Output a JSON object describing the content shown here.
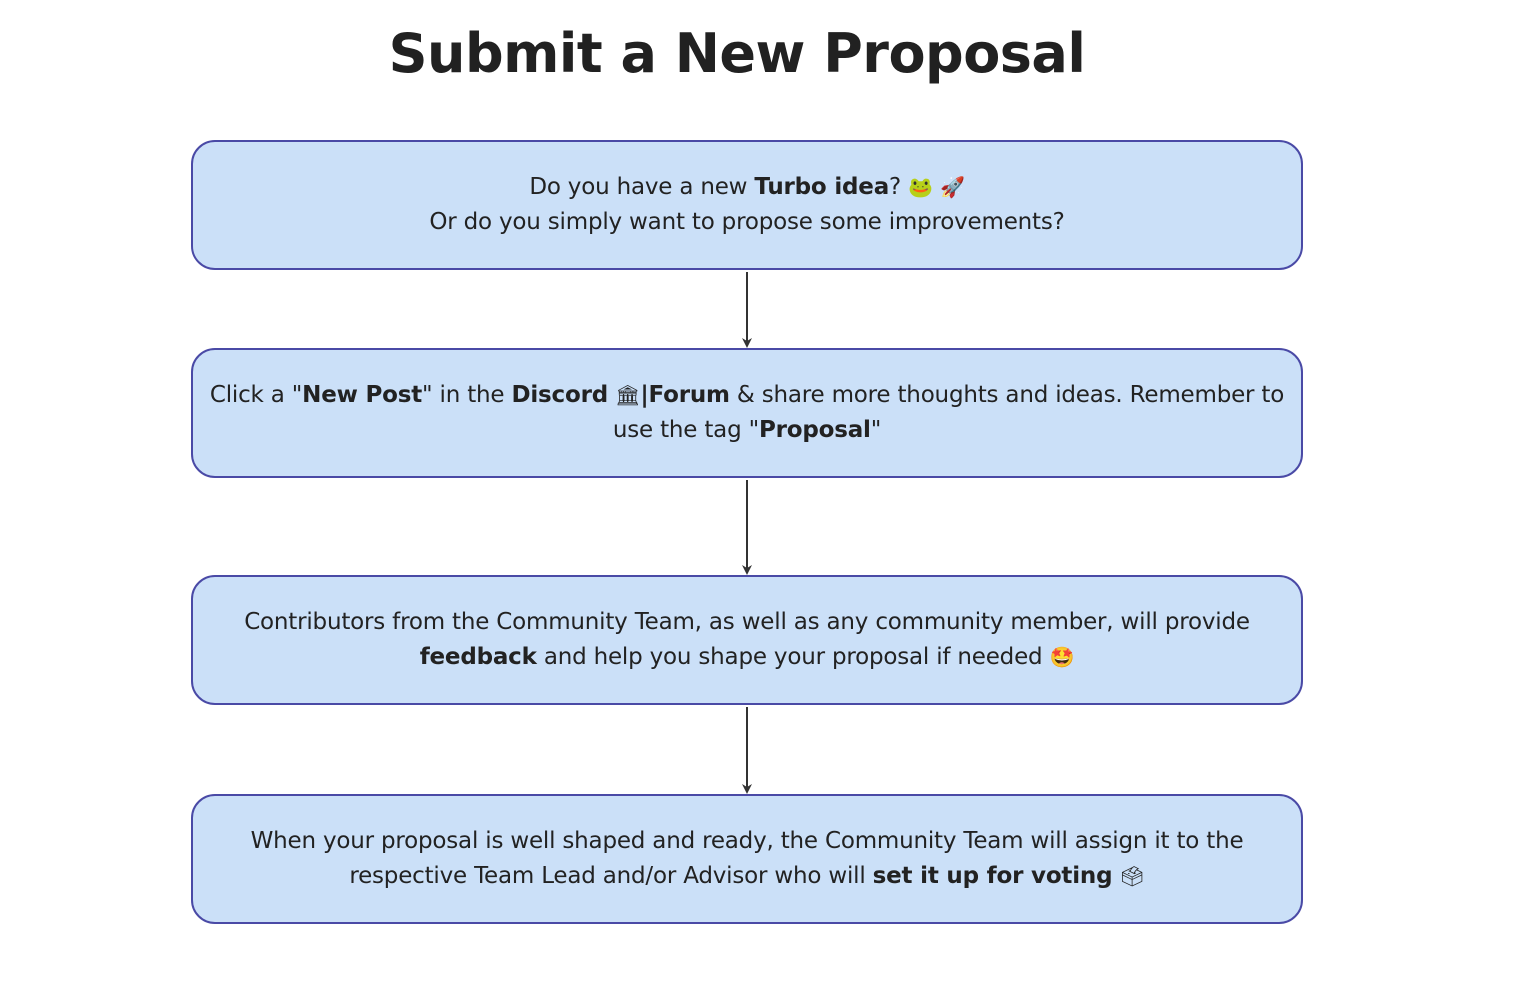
{
  "title": "Submit a New Proposal",
  "steps": [
    {
      "line1_pre": "Do you have a new ",
      "line1_bold": "Turbo idea",
      "line1_post": "?",
      "emoji_frog": "🐸",
      "emoji_rocket": "🚀",
      "line2": "Or do you simply want to propose some improvements?"
    },
    {
      "pre": "Click  a \"",
      "bold1": "New Post",
      "mid1": "\" in the ",
      "bold2": "Discord",
      "emoji_bank": "🏛",
      "bold3": "|Forum",
      "mid2": " & share more thoughts and ideas. Remember to use the tag \"",
      "bold4": "Proposal",
      "post": "\""
    },
    {
      "pre": "Contributors from the Community Team, as well as any community member, will provide ",
      "bold": "feedback",
      "post": " and help you shape your proposal if needed",
      "emoji_star": "🤩"
    },
    {
      "pre": "When your proposal is well shaped and ready, the Community Team will assign it to the respective Team Lead and/or Advisor who will ",
      "bold": "set it up for voting",
      "emoji_ballot": "🗳"
    }
  ],
  "colors": {
    "box_fill": "#cbe0f8",
    "box_border": "#4a4aa6",
    "arrow": "#333333",
    "text": "#222222"
  }
}
